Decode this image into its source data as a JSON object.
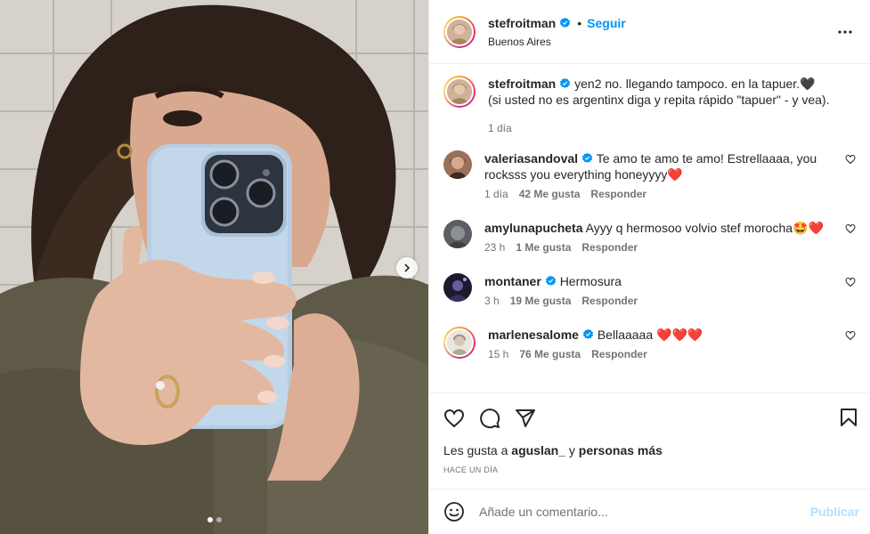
{
  "post": {
    "author": "stefroitman",
    "follow_label": "Seguir",
    "separator": "•",
    "location": "Buenos Aires",
    "caption": "yen2 no. llegando tampoco. en la tapuer.🖤 (si usted no es argentinx diga y repita rápido \"tapuer\" - y vea).",
    "caption_time": "1 día"
  },
  "comments": [
    {
      "user": "valeriasandoval",
      "verified": true,
      "text": "Te amo te amo te amo! Estrellaaaa, you rocksss you everything honeyyyy❤️",
      "time": "1 día",
      "likes": "42 Me gusta",
      "reply": "Responder"
    },
    {
      "user": "amylunapucheta",
      "verified": false,
      "text": "Ayyy q hermosoo volvio stef morocha🤩❤️",
      "time": "23 h",
      "likes": "1 Me gusta",
      "reply": "Responder"
    },
    {
      "user": "montaner",
      "verified": true,
      "text": "Hermosura",
      "time": "3 h",
      "likes": "19 Me gusta",
      "reply": "Responder"
    },
    {
      "user": "marlenesalome",
      "verified": true,
      "text": "Bellaaaaa ❤️❤️❤️",
      "time": "15 h",
      "likes": "76 Me gusta",
      "reply": "Responder"
    }
  ],
  "likes": {
    "prefix": "Les gusta a",
    "user": "aguslan_",
    "joiner": "y",
    "rest": "personas más"
  },
  "timestamp": "HACE UN DÍA",
  "composer": {
    "placeholder": "Añade un comentario...",
    "publish_label": "Publicar"
  },
  "carousel": {
    "slides": 2,
    "active": 1
  },
  "colors": {
    "accent": "#0095f6",
    "text": "#262626",
    "muted": "#737373",
    "publish_disabled": "#b2dffc"
  },
  "icons": [
    "more-options-icon",
    "heart-icon",
    "comment-icon",
    "share-icon",
    "bookmark-icon",
    "emoji-icon",
    "verified-badge-icon",
    "chevron-right-icon"
  ]
}
